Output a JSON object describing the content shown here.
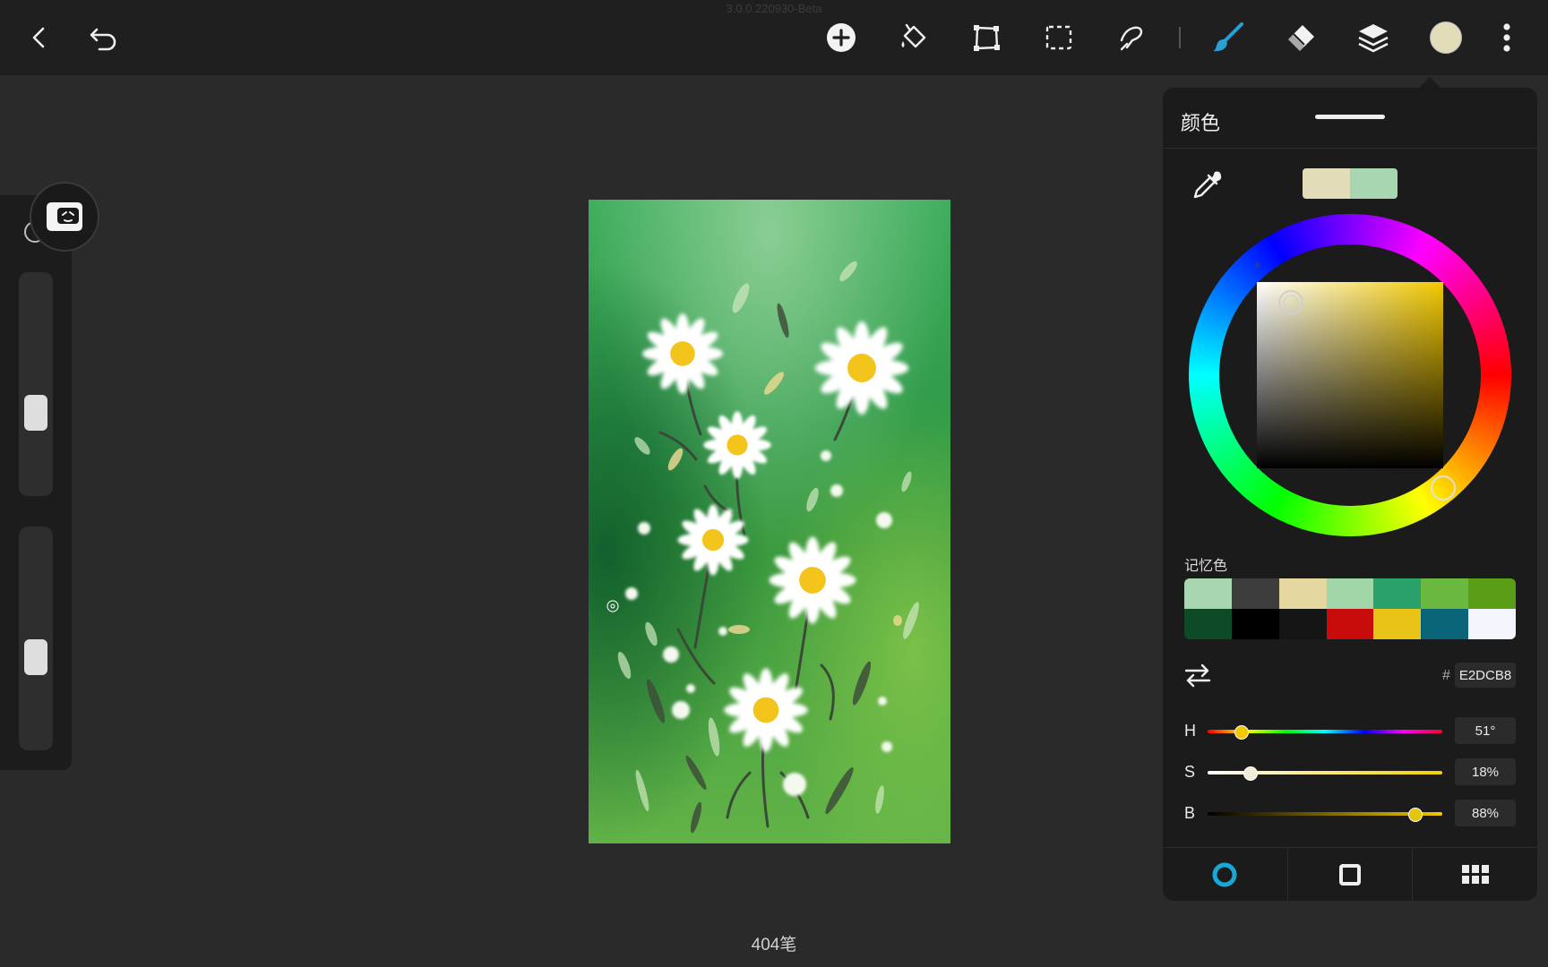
{
  "app": {
    "version": "3.0.0.220930-Beta"
  },
  "toolbar": {
    "back_icon": "chevron-left-icon",
    "undo_icon": "undo-icon",
    "tools": [
      "add-icon",
      "fill-bucket-icon",
      "transform-icon",
      "selection-icon",
      "smudge-icon",
      "brush-icon",
      "eraser-icon",
      "layers-icon",
      "color-icon",
      "more-icon"
    ],
    "active_tool": "brush",
    "current_color": "#E2DCB8",
    "accent": "#2a9fd6"
  },
  "sidebar": {
    "size_level": 0.65,
    "opacity_level": 0.6
  },
  "status": {
    "stroke_count": "404笔"
  },
  "color_panel": {
    "title": "颜色",
    "primary_color": "#E2DCB8",
    "secondary_color": "#A8D6B0",
    "memory_label": "记忆色",
    "memory_colors": [
      "#A8D6B0",
      "#3c3c3c",
      "#E4D8A0",
      "#A0D6A8",
      "#2aa06a",
      "#6ab840",
      "#5a9e18",
      "#0d4a26",
      "#000000",
      "#141414",
      "#c80c0c",
      "#e8c418",
      "#0a6478",
      "#f4f4fc"
    ],
    "hex_prefix": "#",
    "hex_value": "E2DCB8",
    "hue_label": "H",
    "hue_value": "51°",
    "hue_fraction": 0.14,
    "saturation_label": "S",
    "saturation_value": "18%",
    "saturation_fraction": 0.18,
    "brightness_label": "B",
    "brightness_value": "88%",
    "brightness_fraction": 0.88,
    "footer_tabs": [
      "wheel-tab-icon",
      "square-tab-icon",
      "palette-grid-icon"
    ],
    "active_footer_tab": 0
  }
}
